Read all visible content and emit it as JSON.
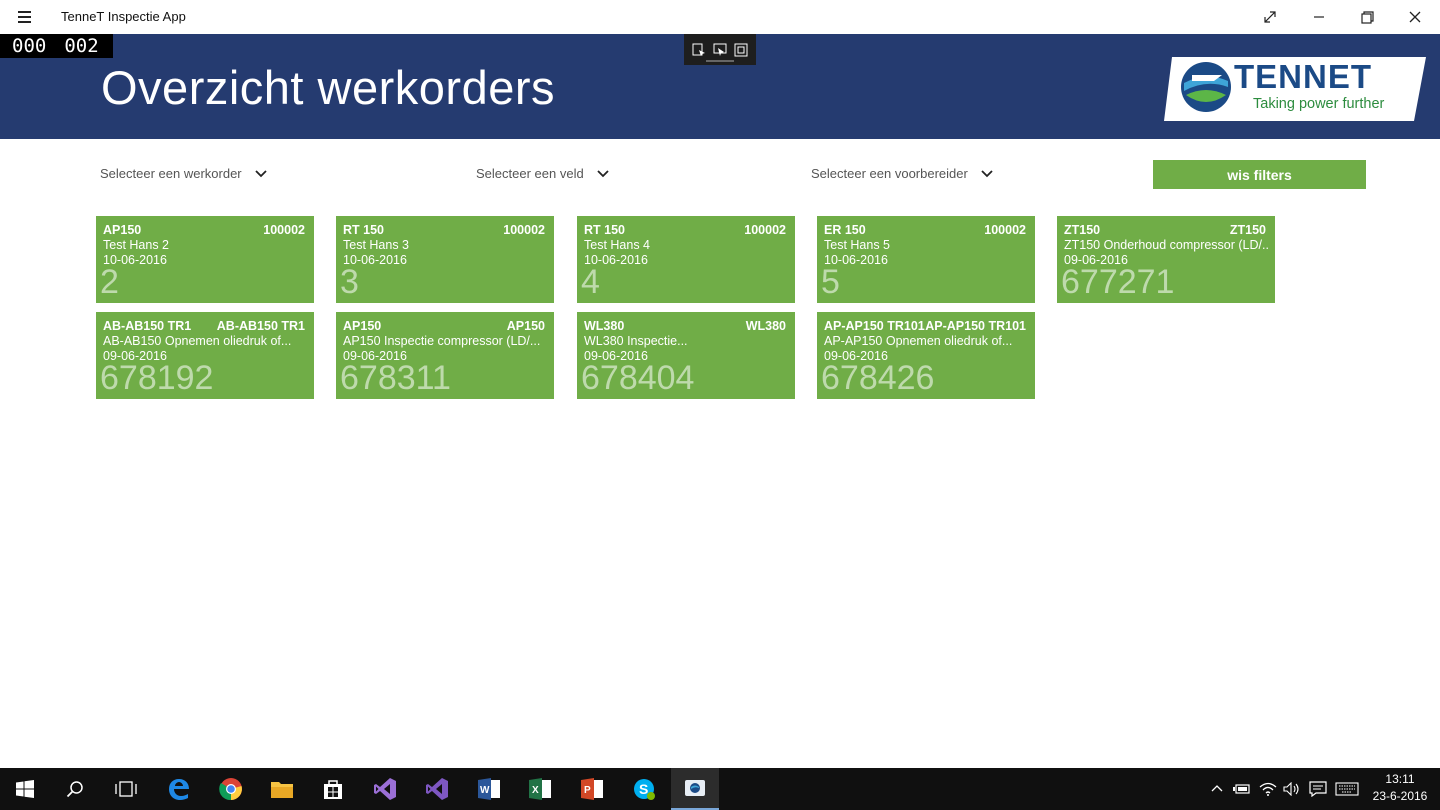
{
  "window": {
    "app_title": "TenneT Inspectie App"
  },
  "counter": {
    "left": "000",
    "right": "002"
  },
  "header": {
    "page_title": "Overzicht werkorders",
    "logo_text": "TENNET",
    "logo_tagline": "Taking power further"
  },
  "filters": {
    "werkorder": "Selecteer een werkorder",
    "veld": "Selecteer een veld",
    "voorbereider": "Selecteer een voorbereider",
    "clear_label": "wis filters"
  },
  "tiles": [
    {
      "code": "AP150",
      "id": "100002",
      "desc": "Test Hans 2",
      "date": "10-06-2016",
      "number": "2"
    },
    {
      "code": "RT 150",
      "id": "100002",
      "desc": "Test Hans 3",
      "date": "10-06-2016",
      "number": "3"
    },
    {
      "code": "RT 150",
      "id": "100002",
      "desc": "Test Hans 4",
      "date": "10-06-2016",
      "number": "4"
    },
    {
      "code": "ER 150",
      "id": "100002",
      "desc": "Test Hans 5",
      "date": "10-06-2016",
      "number": "5"
    },
    {
      "code": "ZT150",
      "id": "ZT150",
      "desc": "ZT150 Onderhoud compressor (LD/...",
      "date": "09-06-2016",
      "number": "677271"
    },
    {
      "code": "AB-AB150 TR1",
      "id": "AB-AB150 TR1",
      "desc": "AB-AB150 Opnemen oliedruk of...",
      "date": "09-06-2016",
      "number": "678192"
    },
    {
      "code": "AP150",
      "id": "AP150",
      "desc": "AP150 Inspectie compressor (LD/...",
      "date": "09-06-2016",
      "number": "678311"
    },
    {
      "code": "WL380",
      "id": "WL380",
      "desc": "WL380 Inspectie...",
      "date": "09-06-2016",
      "number": "678404"
    },
    {
      "code": "AP-AP150 TR101",
      "id": "AP-AP150 TR101",
      "desc": "AP-AP150 Opnemen oliedruk of...",
      "date": "09-06-2016",
      "number": "678426"
    }
  ],
  "taskbar": {
    "time": "13:11",
    "date": "23-6-2016"
  },
  "colors": {
    "header": "#253b70",
    "tile": "#70ad47",
    "taskbar": "#101010"
  }
}
